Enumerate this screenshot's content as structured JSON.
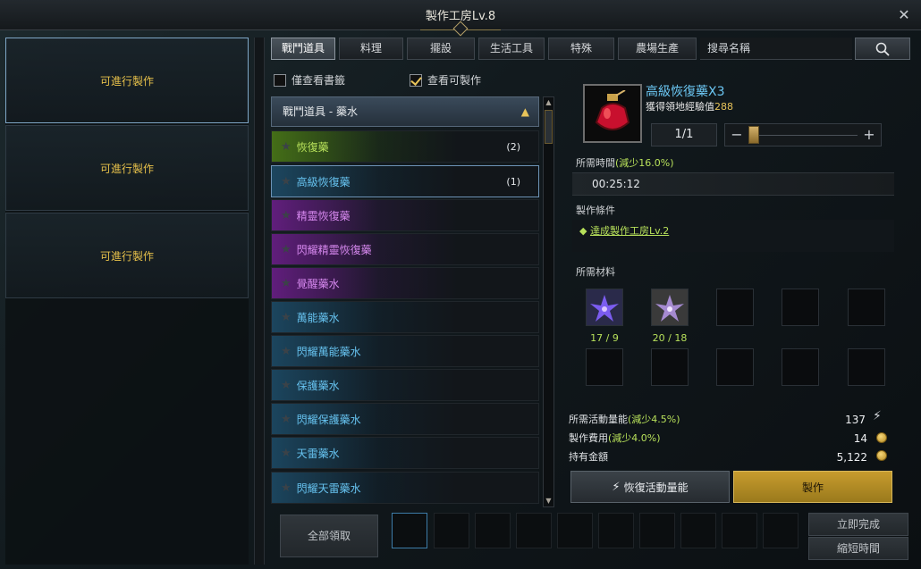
{
  "window": {
    "title": "製作工房Lv.8"
  },
  "queue": {
    "slots": [
      "可進行製作",
      "可進行製作",
      "可進行製作"
    ]
  },
  "tabs": [
    "戰鬥道具",
    "料理",
    "擺設",
    "生活工具",
    "特殊",
    "農場生產"
  ],
  "search": {
    "placeholder": "搜尋名稱"
  },
  "filters": {
    "only_books": "僅查看書籤",
    "craftable_only": "查看可製作",
    "craftable_only_checked": true
  },
  "list": {
    "category": "戰鬥道具 - 藥水",
    "items": [
      {
        "name": "恢復藥",
        "count": "(2)",
        "color": "green"
      },
      {
        "name": "高級恢復藥",
        "count": "(1)",
        "color": "blue",
        "selected": true
      },
      {
        "name": "精靈恢復藥",
        "count": "",
        "color": "purple"
      },
      {
        "name": "閃耀精靈恢復藥",
        "count": "",
        "color": "purple"
      },
      {
        "name": "覺醒藥水",
        "count": "",
        "color": "purple"
      },
      {
        "name": "萬能藥水",
        "count": "",
        "color": "blue"
      },
      {
        "name": "閃耀萬能藥水",
        "count": "",
        "color": "blue"
      },
      {
        "name": "保護藥水",
        "count": "",
        "color": "blue"
      },
      {
        "name": "閃耀保護藥水",
        "count": "",
        "color": "blue"
      },
      {
        "name": "天雷藥水",
        "count": "",
        "color": "blue"
      },
      {
        "name": "閃耀天雷藥水",
        "count": "",
        "color": "blue"
      }
    ]
  },
  "detail": {
    "item_name": "高級恢復藥X3",
    "exp_label": "獲得領地經驗值",
    "exp_value": "288",
    "quantity": "1/1",
    "time_label": "所需時間",
    "time_reduce": "(減少16.0%)",
    "time_value": "00:25:12",
    "cond_label": "製作條件",
    "cond_text": "達成製作工房Lv.2",
    "materials_label": "所需材料",
    "materials": [
      {
        "icon": "purple-flower-icon",
        "count": "17 / 9"
      },
      {
        "icon": "lavender-flower-icon",
        "count": "20 / 18"
      }
    ],
    "energy_label": "所需活動量能",
    "energy_reduce": "(減少4.5%)",
    "energy_value": "137",
    "fee_label": "製作費用",
    "fee_reduce": "(減少4.0%)",
    "fee_value": "14",
    "gold_label": "持有金額",
    "gold_value": "5,122",
    "restore_button": "恢復活動量能",
    "craft_button": "製作"
  },
  "bottom": {
    "claim_all": "全部領取",
    "instant": "立即完成",
    "shorten": "縮短時間"
  },
  "colors": {
    "accent_gold": "#e8c45a",
    "green": "#b7e05a",
    "blue": "#6bc6f2"
  }
}
